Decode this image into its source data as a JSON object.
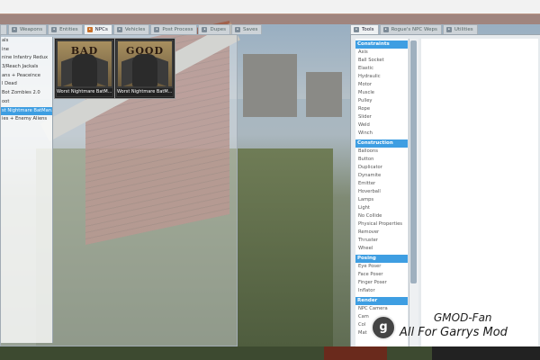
{
  "spawnmenu": {
    "tabs": [
      {
        "label": "",
        "icon": "list-icon"
      },
      {
        "label": "Weapons",
        "icon": "gun-icon"
      },
      {
        "label": "Entities",
        "icon": "entity-icon"
      },
      {
        "label": "NPCs",
        "icon": "npc-icon"
      },
      {
        "label": "Vehicles",
        "icon": "car-icon"
      },
      {
        "label": "Post Process",
        "icon": "postprocess-icon"
      },
      {
        "label": "Dupes",
        "icon": "dupe-icon"
      },
      {
        "label": "Saves",
        "icon": "save-icon"
      }
    ],
    "categories": [
      "als",
      "ine",
      "nine Infantry Redux",
      "3/Reach Jackals",
      "ans + Peaceince",
      "l Dead",
      "Bot Zombies 2.0",
      "oot",
      "st Nightmare BatMan...",
      "ies + Enemy Aliens"
    ],
    "selected_category_index": 8,
    "npcs": [
      {
        "art_text": "BAD",
        "label": "Worst Nightmare BatM..."
      },
      {
        "art_text": "GOOD",
        "label": "Worst Nightmare BatM..."
      }
    ]
  },
  "toolmenu": {
    "tabs": [
      {
        "label": "Tools",
        "icon": "wrench-icon"
      },
      {
        "label": "Rogue's NPC Weps",
        "icon": "npc-weapon-icon"
      },
      {
        "label": "Utilities",
        "icon": "utilities-icon"
      }
    ],
    "groups": [
      {
        "name": "Constraints",
        "items": [
          "Axis",
          "Ball Socket",
          "Elastic",
          "Hydraulic",
          "Motor",
          "Muscle",
          "Pulley",
          "Rope",
          "Slider",
          "Weld",
          "Winch"
        ]
      },
      {
        "name": "Construction",
        "items": [
          "Balloons",
          "Button",
          "Duplicator",
          "Dynamite",
          "Emitter",
          "Hoverball",
          "Lamps",
          "Light",
          "No Collide",
          "Physical Properties",
          "Remover",
          "Thruster",
          "Wheel"
        ]
      },
      {
        "name": "Posing",
        "items": [
          "Eye Poser",
          "Face Poser",
          "Finger Poser",
          "Inflator"
        ]
      },
      {
        "name": "Render",
        "items": [
          "NPC Camera",
          "Cam",
          "Col",
          "Mat"
        ]
      }
    ]
  },
  "watermark": {
    "line1": "GMOD-Fan",
    "line2": "All For Garrys Mod",
    "logo_letter": "g"
  },
  "colors": {
    "accent": "#3e9ee2",
    "panel": "#e6eaed"
  }
}
